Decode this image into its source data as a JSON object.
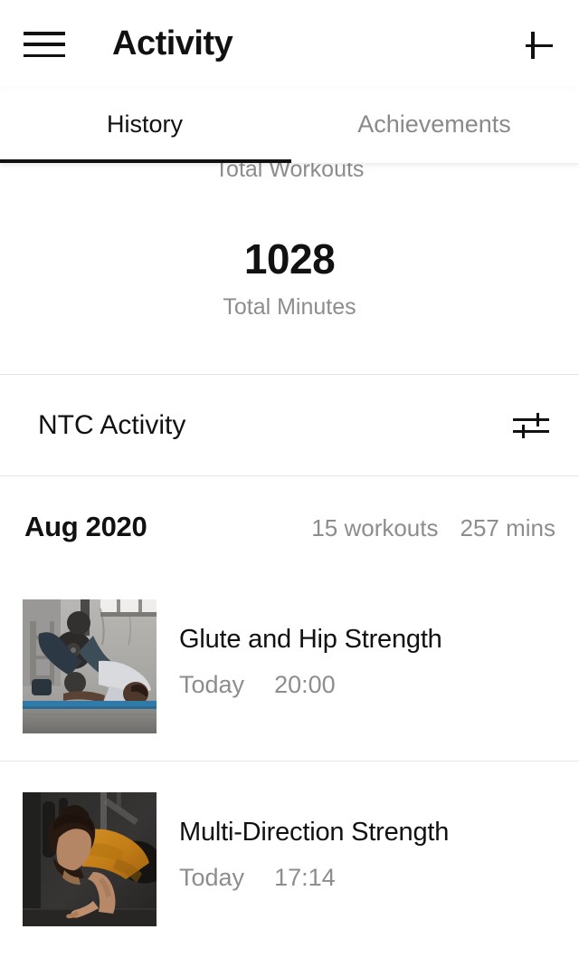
{
  "appbar": {
    "menu_icon": "hamburger-menu-icon",
    "title": "Activity",
    "add_icon": "plus-icon"
  },
  "tabs": [
    {
      "label": "History",
      "active": true
    },
    {
      "label": "Achievements",
      "active": false
    }
  ],
  "stats": {
    "clipped_label": "Total Workouts",
    "value": "1028",
    "value_label": "Total Minutes"
  },
  "section": {
    "title": "NTC Activity",
    "filter_icon": "filter-sliders-icon"
  },
  "month": {
    "name": "Aug 2020",
    "workouts": "15 workouts",
    "minutes": "257 mins"
  },
  "workouts": [
    {
      "title": "Glute and Hip Strength",
      "day": "Today",
      "time": "20:00",
      "thumbnail": "glute-bridge-gym-photo"
    },
    {
      "title": "Multi-Direction Strength",
      "day": "Today",
      "time": "17:14",
      "thumbnail": "woman-orange-shirt-gym-photo"
    }
  ],
  "colors": {
    "text_primary": "#111111",
    "text_secondary": "#8d8d8d",
    "background": "#ffffff",
    "divider": "#e6e6e6",
    "accent_underline": "#111111"
  }
}
